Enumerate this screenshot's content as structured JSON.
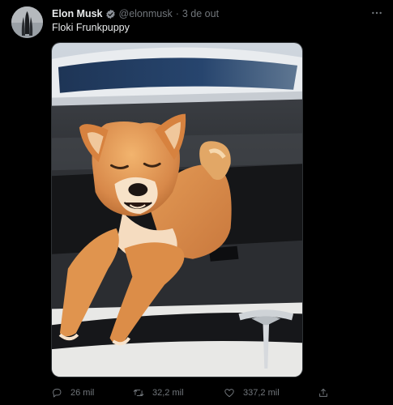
{
  "tweet": {
    "author": {
      "name": "Elon Musk",
      "handle": "@elonmusk",
      "separator": "·",
      "timestamp": "3 de out",
      "verified": true
    },
    "text": "Floki Frunkpuppy",
    "media": {
      "subject": "shiba inu puppy sitting in a car front trunk"
    },
    "actions": {
      "reply_count": "26 mil",
      "retweet_count": "32,2 mil",
      "like_count": "337,2 mil"
    }
  },
  "icons": {
    "verified": "verified-badge-icon",
    "more": "more-horizontal-icon",
    "reply": "reply-icon",
    "retweet": "retweet-icon",
    "like": "heart-icon",
    "share": "share-icon"
  },
  "colors": {
    "background": "#000000",
    "text_primary": "#e7e9ea",
    "text_secondary": "#71767b",
    "verified_badge": "#8a8f96"
  }
}
